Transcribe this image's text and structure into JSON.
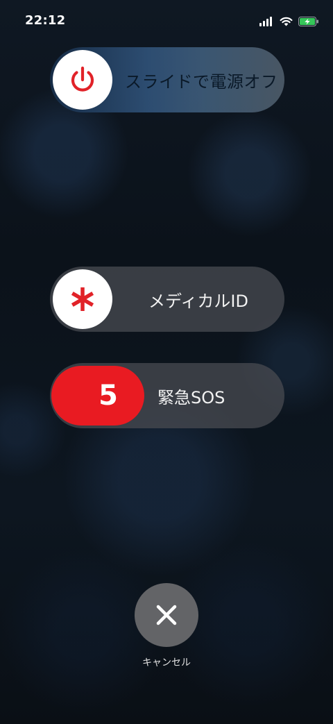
{
  "status_bar": {
    "time": "22:12",
    "icons": [
      "cellular-signal-icon",
      "wifi-icon",
      "battery-charging-icon"
    ]
  },
  "power_off_slider": {
    "label": "スライドで電源オフ",
    "knob_icon": "power-icon"
  },
  "medical_id_slider": {
    "label": "メディカルID",
    "knob_icon": "medical-asterisk-icon"
  },
  "sos_slider": {
    "countdown": "5",
    "label": "緊急SOS"
  },
  "cancel": {
    "label": "キャンセル",
    "icon": "close-icon"
  },
  "colors": {
    "power_icon": "#e12228",
    "medical_icon": "#e12228",
    "sos_knob": "#e91b22",
    "battery_charging": "#35c759"
  }
}
